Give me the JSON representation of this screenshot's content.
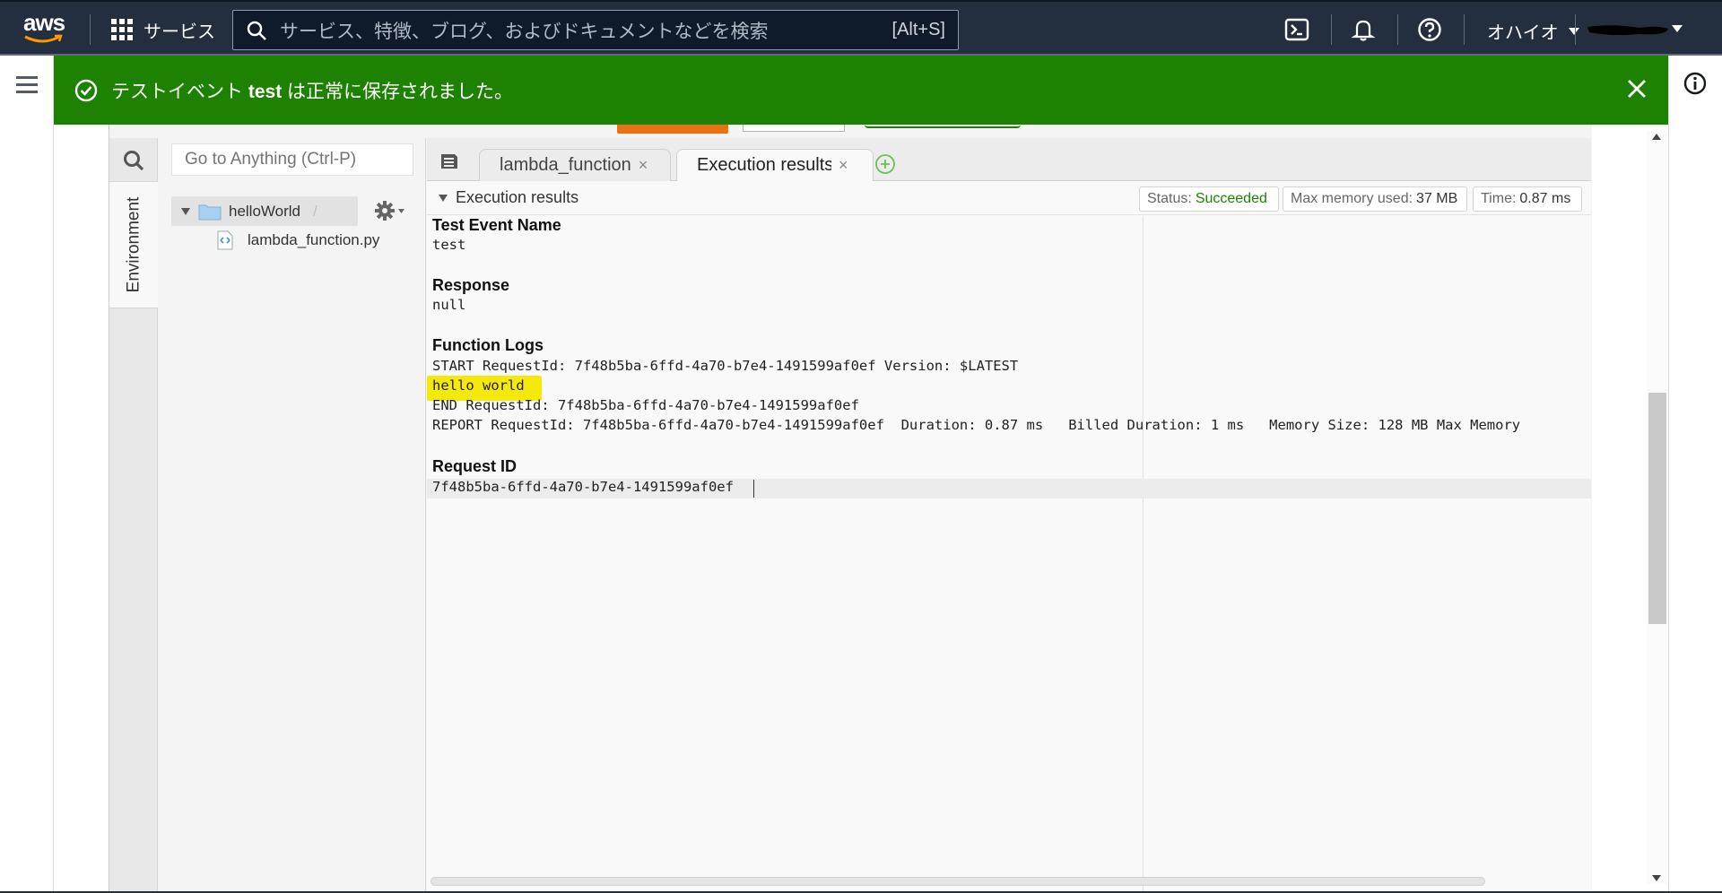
{
  "topnav": {
    "logo_text": "aws",
    "services_label": "サービス",
    "search_placeholder": "サービス、特徴、ブログ、およびドキュメントなどを検索",
    "search_shortcut": "[Alt+S]",
    "icons": [
      "cloudshell-icon",
      "bell-icon",
      "help-icon"
    ],
    "region_label": "オハイオ"
  },
  "flash": {
    "prefix": "テストイベント ",
    "event_name": "test",
    "suffix": " は正常に保存されました。",
    "color": "#1d8102"
  },
  "ide": {
    "activity": {
      "environment_label": "Environment"
    },
    "goto_placeholder": "Go to Anything (Ctrl-P)",
    "tree": {
      "root_label": "helloWorld",
      "root_suffix": "/",
      "file_label": "lambda_function.py"
    },
    "tabs": [
      {
        "label": "lambda_function",
        "close": "×"
      },
      {
        "label": "Execution results",
        "close": "×"
      }
    ],
    "results": {
      "title": "Execution results",
      "status_label": "Status:",
      "status_value": "Succeeded",
      "memory_label": "Max memory used:",
      "memory_value": "37 MB",
      "time_label": "Time:",
      "time_value": "0.87 ms",
      "sections": {
        "test_event_name_heading": "Test Event Name",
        "test_event_name_value": "test",
        "response_heading": "Response",
        "response_value": "null",
        "function_logs_heading": "Function Logs",
        "log_lines": [
          "START RequestId: 7f48b5ba-6ffd-4a70-b7e4-1491599af0ef Version: $LATEST",
          "hello world",
          "END RequestId: 7f48b5ba-6ffd-4a70-b7e4-1491599af0ef",
          "REPORT RequestId: 7f48b5ba-6ffd-4a70-b7e4-1491599af0ef  Duration: 0.87 ms   Billed Duration: 1 ms   Memory Size: 128 MB Max Memory"
        ],
        "request_id_heading": "Request ID",
        "request_id_value": "7f48b5ba-6ffd-4a70-b7e4-1491599af0ef"
      },
      "highlight_color": "#f5e90c",
      "success_color": "#1d8102"
    }
  }
}
